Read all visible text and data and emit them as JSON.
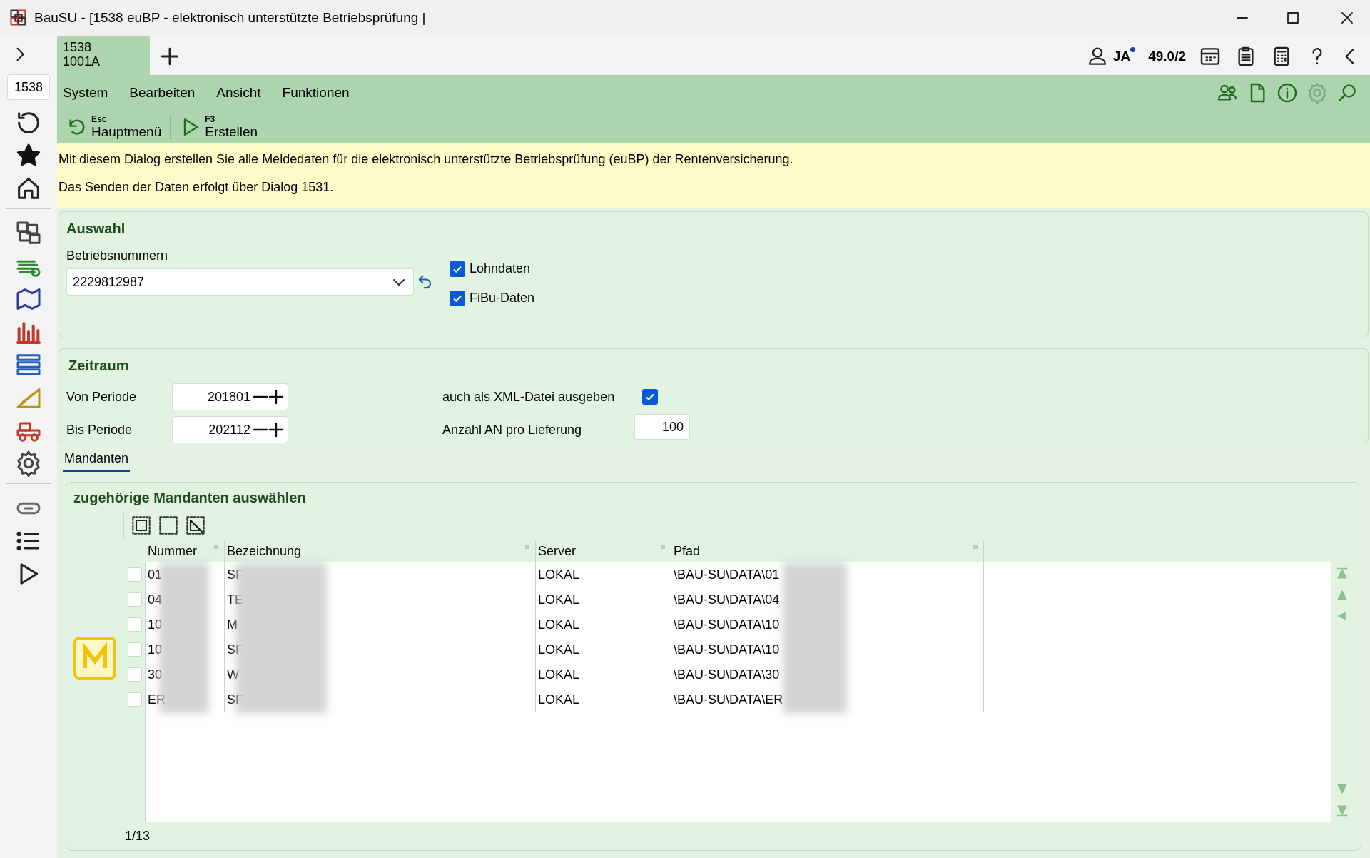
{
  "window": {
    "title": "BauSU - [1538 euBP - elektronisch unterstützte Betriebsprüfung |"
  },
  "sidebar": {
    "dialog_field": "1538"
  },
  "tabs": [
    {
      "line1": "1538",
      "line2": "1001A",
      "selected": true
    }
  ],
  "header_right": {
    "user": "JA",
    "version": "49.0/2"
  },
  "menu": [
    "System",
    "Bearbeiten",
    "Ansicht",
    "Funktionen"
  ],
  "toolbar": [
    {
      "key": "Esc",
      "label": "Hauptmenü",
      "kind": "back"
    },
    {
      "key": "F3",
      "label": "Erstellen",
      "kind": "play"
    }
  ],
  "info": [
    "Mit diesem Dialog erstellen Sie alle Meldedaten für die elektronisch unterstützte Betriebsprüfung (euBP) der Rentenversicherung.",
    "Das Senden der Daten erfolgt über Dialog 1531."
  ],
  "auswahl": {
    "title": "Auswahl",
    "field_label": "Betriebsnummern",
    "value": "2229812987",
    "checkboxes": [
      {
        "label": "Lohndaten",
        "checked": true
      },
      {
        "label": "FiBu-Daten",
        "checked": true
      }
    ]
  },
  "zeitraum": {
    "title": "Zeitraum",
    "periods": [
      {
        "label": "Von Periode",
        "value": "201801"
      },
      {
        "label": "Bis Periode",
        "value": "202112"
      }
    ],
    "xml": {
      "label": "auch als XML-Datei ausgeben",
      "checked": true
    },
    "anzahl": {
      "label": "Anzahl AN pro Lieferung",
      "value": "100"
    }
  },
  "section_tabs": [
    {
      "label": "Mandanten",
      "selected": true
    }
  ],
  "mandanten": {
    "title": "zugehörige Mandanten auswählen",
    "columns": [
      "Nummer",
      "Bezeichnung",
      "Server",
      "Pfad"
    ],
    "rows": [
      {
        "checked": false,
        "cells": [
          "01",
          "SF",
          "LOKAL",
          "\\BAU-SU\\DATA\\01"
        ]
      },
      {
        "checked": false,
        "cells": [
          "04",
          "TE",
          "LOKAL",
          "\\BAU-SU\\DATA\\04"
        ]
      },
      {
        "checked": false,
        "cells": [
          "10",
          "M",
          "LOKAL",
          "\\BAU-SU\\DATA\\10"
        ]
      },
      {
        "checked": false,
        "cells": [
          "10",
          "SF",
          "LOKAL",
          "\\BAU-SU\\DATA\\10"
        ]
      },
      {
        "checked": false,
        "cells": [
          "30",
          "W",
          "LOKAL",
          "\\BAU-SU\\DATA\\30"
        ]
      },
      {
        "checked": false,
        "cells": [
          "ER",
          "SF",
          "LOKAL",
          "\\BAU-SU\\DATA\\ER"
        ]
      }
    ],
    "pager": "1/13"
  }
}
